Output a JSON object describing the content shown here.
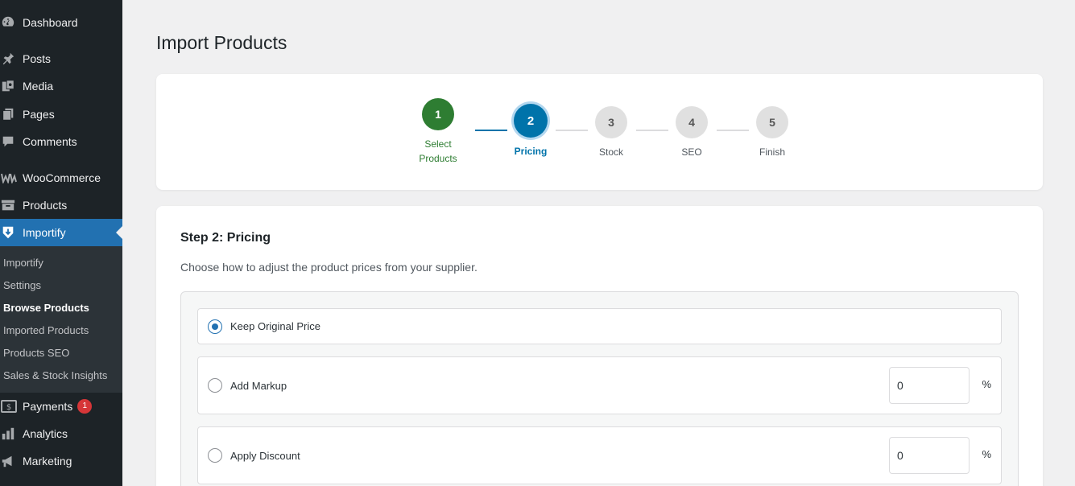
{
  "page_title": "Import Products",
  "colors": {
    "accent": "#2271b1",
    "step_done": "#2e7d32",
    "step_active": "#0073aa",
    "step_pending": "#e0e0e0",
    "sidebar_bg": "#1d2327",
    "submenu_bg": "#2c3338",
    "badge": "#d63638"
  },
  "sidebar": {
    "items": [
      {
        "label": "Dashboard",
        "icon": "dashboard-icon"
      },
      {
        "label": "Posts",
        "icon": "pin-icon"
      },
      {
        "label": "Media",
        "icon": "media-icon"
      },
      {
        "label": "Pages",
        "icon": "pages-icon"
      },
      {
        "label": "Comments",
        "icon": "comment-icon"
      },
      {
        "label": "WooCommerce",
        "icon": "woocommerce-icon"
      },
      {
        "label": "Products",
        "icon": "archive-icon"
      },
      {
        "label": "Importify",
        "icon": "importify-icon"
      },
      {
        "label": "Payments",
        "icon": "dollar-icon",
        "badge": "1"
      },
      {
        "label": "Analytics",
        "icon": "bar-chart-icon"
      },
      {
        "label": "Marketing",
        "icon": "megaphone-icon"
      }
    ],
    "submenu": [
      {
        "label": "Importify"
      },
      {
        "label": "Settings"
      },
      {
        "label": "Browse Products"
      },
      {
        "label": "Imported Products"
      },
      {
        "label": "Products SEO"
      },
      {
        "label": "Sales & Stock Insights"
      }
    ]
  },
  "stepper": {
    "steps": [
      {
        "number": "1",
        "label_line1": "Select",
        "label_line2": "Products",
        "state": "done"
      },
      {
        "number": "2",
        "label": "Pricing",
        "state": "active"
      },
      {
        "number": "3",
        "label": "Stock",
        "state": "pending"
      },
      {
        "number": "4",
        "label": "SEO",
        "state": "pending"
      },
      {
        "number": "5",
        "label": "Finish",
        "state": "pending"
      }
    ]
  },
  "form": {
    "heading": "Step 2: Pricing",
    "description": "Choose how to adjust the product prices from your supplier.",
    "options": [
      {
        "label": "Keep Original Price",
        "selected": true
      },
      {
        "label": "Add Markup",
        "selected": false,
        "value": "0",
        "unit": "%"
      },
      {
        "label": "Apply Discount",
        "selected": false,
        "value": "0",
        "unit": "%"
      }
    ]
  }
}
